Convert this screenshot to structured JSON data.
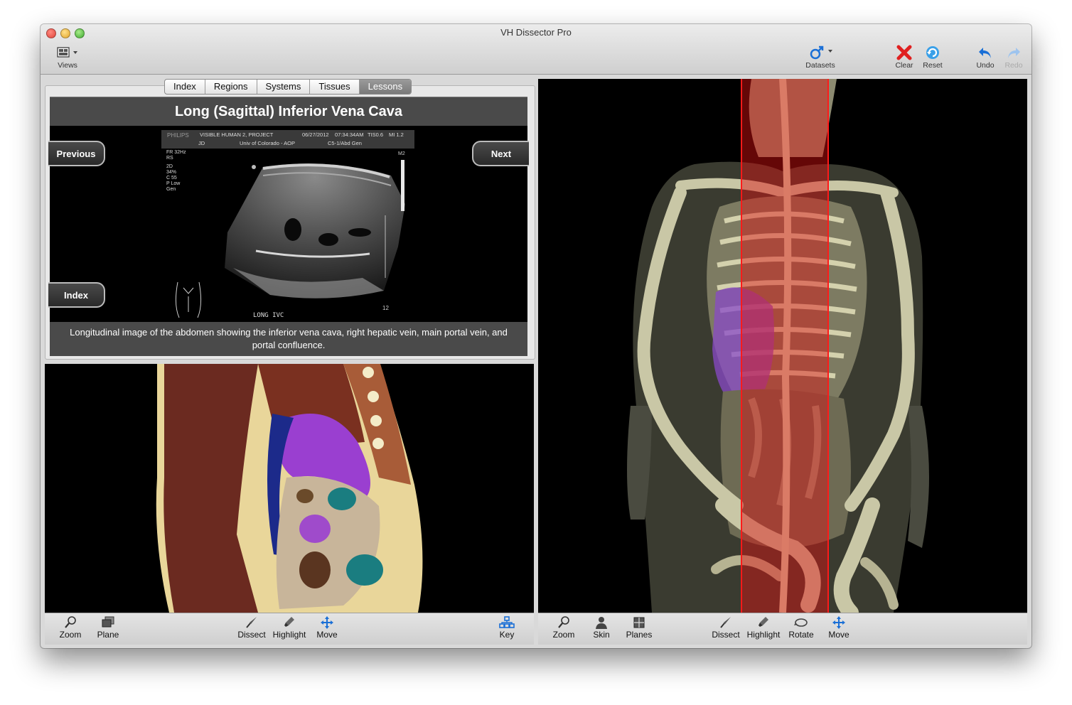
{
  "window": {
    "title": "VH Dissector Pro"
  },
  "toolbar": {
    "views_label": "Views",
    "datasets_label": "Datasets",
    "clear_label": "Clear",
    "reset_label": "Reset",
    "undo_label": "Undo",
    "redo_label": "Redo"
  },
  "tabs": [
    "Index",
    "Regions",
    "Systems",
    "Tissues",
    "Lessons"
  ],
  "active_tab": "Lessons",
  "lesson": {
    "title": "Long (Sagittal) Inferior Vena Cava",
    "previous_label": "Previous",
    "next_label": "Next",
    "index_label": "Index",
    "caption": "Longitudinal image of the abdomen showing the inferior vena cava, right hepatic vein, main portal vein, and portal confluence.",
    "ultrasound": {
      "brand": "PHILIPS",
      "project": "VISIBLE HUMAN 2, PROJECT",
      "date": "06/27/2012",
      "time": "07:34:34AM",
      "tis": "TIS0.6",
      "mi": "MI 1.2",
      "operator": "JD",
      "institution": "Univ of Colorado - AOP",
      "probe": "C5-1/Abd Gen",
      "side_info": [
        "FR 32Hz",
        "RS",
        "",
        "2D",
        "34%",
        "C 55",
        "P Low",
        "Gen"
      ],
      "scale_label": "M2",
      "depth_label": "12",
      "image_label": "LONG IVC"
    }
  },
  "slice_toolbar": {
    "zoom_label": "Zoom",
    "plane_label": "Plane",
    "dissect_label": "Dissect",
    "highlight_label": "Highlight",
    "move_label": "Move",
    "key_label": "Key"
  },
  "view3d_toolbar": {
    "zoom_label": "Zoom",
    "skin_label": "Skin",
    "planes_label": "Planes",
    "dissect_label": "Dissect",
    "highlight_label": "Highlight",
    "rotate_label": "Rotate",
    "move_label": "Move"
  },
  "colors": {
    "accent_blue": "#1a6fd6",
    "clear_red": "#e02020",
    "highlight_purple": "#9a3fd0",
    "plane_red": "#e01010"
  }
}
